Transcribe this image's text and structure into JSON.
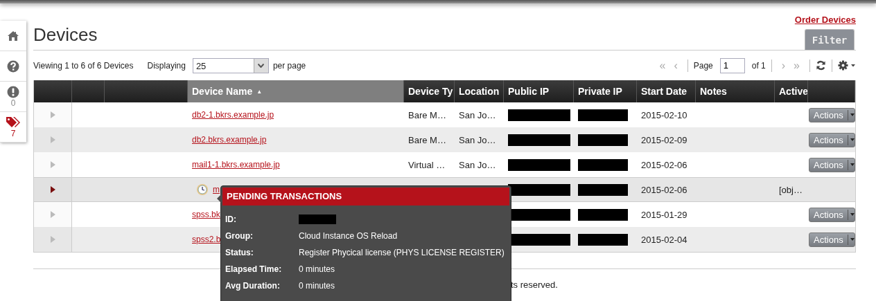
{
  "sidebar": {
    "items": [
      {
        "kind": "home"
      },
      {
        "kind": "help"
      },
      {
        "kind": "alert",
        "count": "0"
      },
      {
        "kind": "tags",
        "count": "7"
      }
    ]
  },
  "header": {
    "title": "Devices",
    "order_link": "Order Devices",
    "filter_tab": "Filter"
  },
  "toolbar": {
    "summary": "Viewing 1 to 6 of 6 Devices",
    "displaying_label": "Displaying",
    "per_page": "25",
    "per_page_suffix": "per page",
    "pager_back": [
      {
        "symbol": "«",
        "disabled": true
      },
      {
        "symbol": "‹",
        "disabled": true
      }
    ],
    "page_label": "Page",
    "page": "1",
    "page_of": "of 1",
    "pager_forward": [
      {
        "symbol": "›",
        "disabled": true
      },
      {
        "symbol": "»",
        "disabled": true
      }
    ]
  },
  "table": {
    "columns": [
      {
        "kind": "blank",
        "sorted": false
      },
      {
        "kind": "blank",
        "sorted": false
      },
      {
        "kind": "blank",
        "sorted": false
      },
      {
        "kind": "text",
        "label": "Device Name",
        "sort_mark": "▲",
        "sorted": true
      },
      {
        "kind": "text",
        "label": "Device Ty",
        "sorted": false
      },
      {
        "kind": "text",
        "label": "Location",
        "sorted": false
      },
      {
        "kind": "text",
        "label": "Public IP",
        "sorted": false
      },
      {
        "kind": "text",
        "label": "Private IP",
        "sorted": false
      },
      {
        "kind": "text",
        "label": "Start Date",
        "sorted": false
      },
      {
        "kind": "text",
        "label": "Notes",
        "sorted": false
      },
      {
        "kind": "text",
        "label": "Active",
        "sorted": false
      },
      {
        "kind": "blank",
        "sorted": false
      }
    ],
    "rows": [
      {
        "expanded": false,
        "pending": false,
        "name": "db2-1.bkrs.example.jp",
        "device_type": "Bare M…",
        "location": "San Jo…",
        "public_ip_redacted": true,
        "private_ip_redacted": true,
        "start_date": "2015-02-10",
        "actions": "Actions"
      },
      {
        "expanded": false,
        "pending": false,
        "name": "db2.bkrs.example.jp",
        "device_type": "Bare M…",
        "location": "San Jo…",
        "public_ip_redacted": true,
        "private_ip_redacted": true,
        "start_date": "2015-02-09",
        "actions": "Actions"
      },
      {
        "expanded": false,
        "pending": false,
        "name": "mail1-1.bkrs.example.jp",
        "device_type": "Virtual …",
        "location": "San Jo…",
        "public_ip_redacted": true,
        "private_ip_redacted": true,
        "start_date": "2015-02-06",
        "actions": "Actions"
      },
      {
        "expanded": true,
        "pending": true,
        "name": "m",
        "public_ip_redacted": true,
        "private_ip_redacted": true,
        "start_date": "2015-02-06",
        "active": "[obj…"
      },
      {
        "expanded": false,
        "pending": false,
        "name": "spss.bk",
        "public_ip_redacted": true,
        "private_ip_redacted": true,
        "start_date": "2015-01-29",
        "actions": "Actions"
      },
      {
        "expanded": false,
        "pending": false,
        "name": "spss2.b",
        "public_ip_redacted": true,
        "private_ip_redacted": true,
        "start_date": "2015-02-04",
        "actions": "Actions"
      }
    ]
  },
  "footer": {
    "text": "ts reserved."
  },
  "tooltip": {
    "title": "PENDING TRANSACTIONS",
    "fields": [
      {
        "label": "ID:",
        "redacted": true
      },
      {
        "label": "Group:",
        "value": "Cloud Instance OS Reload",
        "redacted": false
      },
      {
        "label": "Status:",
        "value": "Register Phycical license (PHYS LICENSE REGISTER)",
        "redacted": false
      },
      {
        "label": "Elapsed Time:",
        "value": "0 minutes",
        "redacted": false
      },
      {
        "label": "Avg Duration:",
        "value": "0 minutes",
        "redacted": false
      }
    ]
  }
}
